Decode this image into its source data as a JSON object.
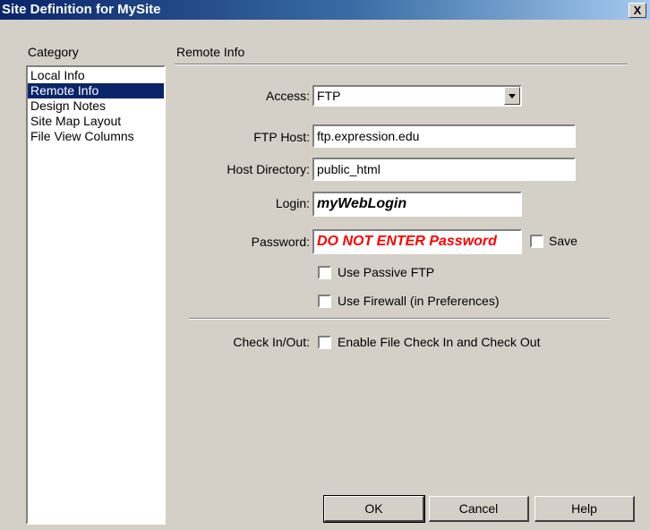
{
  "window": {
    "title": "Site Definition for MySite",
    "close_label": "X"
  },
  "category": {
    "header": "Category",
    "items": [
      {
        "label": "Local Info"
      },
      {
        "label": "Remote Info",
        "selected": true
      },
      {
        "label": "Design Notes"
      },
      {
        "label": "Site Map Layout"
      },
      {
        "label": "File View Columns"
      }
    ]
  },
  "remote": {
    "section_title": "Remote Info",
    "access_label": "Access:",
    "access_value": "FTP",
    "ftp_host_label": "FTP Host:",
    "ftp_host_value": "ftp.expression.edu",
    "host_dir_label": "Host Directory:",
    "host_dir_value": "public_html",
    "login_label": "Login:",
    "login_value": "myWebLogin",
    "password_label": "Password:",
    "password_value": "DO NOT ENTER Password",
    "save_label": "Save",
    "passive_ftp_label": "Use Passive FTP",
    "firewall_label": "Use Firewall (in Preferences)",
    "checkin_label": "Check In/Out:",
    "checkin_option_label": "Enable File Check In and Check Out"
  },
  "buttons": {
    "ok": "OK",
    "cancel": "Cancel",
    "help": "Help"
  },
  "colors": {
    "titlebar": "#0a246a",
    "selection": "#0a246a",
    "password_text": "#ff0000",
    "dialog_bg": "#d4d0c8"
  }
}
